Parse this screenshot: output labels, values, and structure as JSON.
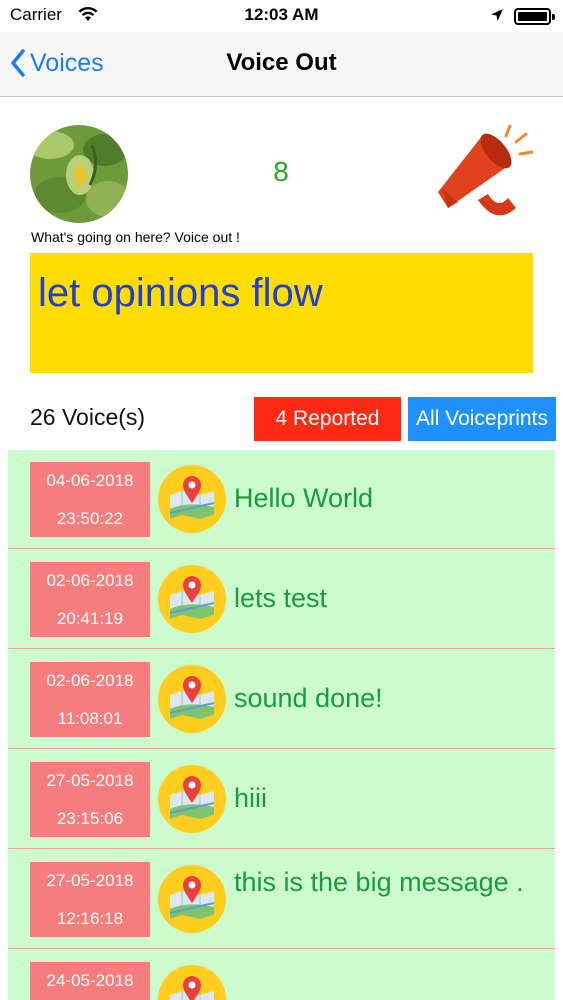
{
  "status": {
    "carrier": "Carrier",
    "time": "12:03 AM"
  },
  "nav": {
    "back_label": "Voices",
    "title": "Voice Out"
  },
  "header": {
    "count": "8",
    "caption": "What's going on here? Voice out !",
    "banner": "let opinions flow"
  },
  "summary": {
    "voices": "26 Voice(s)",
    "reported_label": "4 Reported",
    "voiceprints_label": "All Voiceprints"
  },
  "voices": [
    {
      "date": "04-06-2018",
      "time": "23:50:22",
      "message": "Hello World"
    },
    {
      "date": "02-06-2018",
      "time": "20:41:19",
      "message": "lets test"
    },
    {
      "date": "02-06-2018",
      "time": "11:08:01",
      "message": "sound done!"
    },
    {
      "date": "27-05-2018",
      "time": "23:15:06",
      "message": "hiii"
    },
    {
      "date": "27-05-2018",
      "time": "12:16:18",
      "message": "this is the big message ."
    },
    {
      "date": "24-05-2018",
      "time": "",
      "message": ""
    }
  ],
  "colors": {
    "accent": "#1a7cf5",
    "banner_bg": "#ffdd00",
    "banner_text": "#1f3fd6",
    "reported_bg": "#ff2a14",
    "voiceprints_bg": "#1e90ff",
    "list_bg": "#ccfcce",
    "date_bg": "#f57d7d",
    "message_text": "#1a9a3f"
  },
  "icons": [
    "wifi-icon",
    "location-arrow-icon",
    "battery-icon",
    "chevron-left-icon",
    "megaphone-icon",
    "map-pin-icon"
  ]
}
